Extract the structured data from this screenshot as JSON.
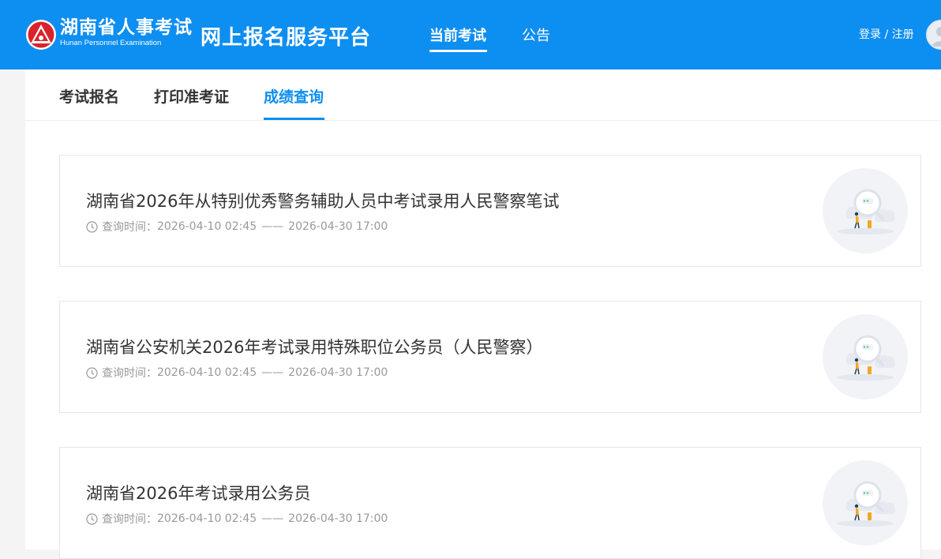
{
  "header": {
    "logo_cn": "湖南省人事考试",
    "logo_en": "Hunan Personnel Examination",
    "platform_title": "网上报名服务平台",
    "nav": [
      {
        "label": "当前考试",
        "active": true
      },
      {
        "label": "公告",
        "active": false
      }
    ],
    "auth_label": "登录 / 注册"
  },
  "subtabs": [
    {
      "label": "考试报名",
      "active": false
    },
    {
      "label": "打印准考证",
      "active": false
    },
    {
      "label": "成绩查询",
      "active": true
    }
  ],
  "exams": [
    {
      "title": "湖南省2026年从特别优秀警务辅助人员中考试录用人民警察笔试",
      "time_label": "查询时间：",
      "start": "2026-04-10 02:45",
      "separator": "——",
      "end": "2026-04-30 17:00"
    },
    {
      "title": "湖南省公安机关2026年考试录用特殊职位公务员（人民警察）",
      "time_label": "查询时间：",
      "start": "2026-04-10 02:45",
      "separator": "——",
      "end": "2026-04-30 17:00"
    },
    {
      "title": "湖南省2026年考试录用公务员",
      "time_label": "查询时间：",
      "start": "2026-04-10 02:45",
      "separator": "——",
      "end": "2026-04-30 17:00"
    }
  ],
  "icons": {
    "logo": "hunan-exam-logo-icon",
    "avatar": "user-avatar-icon",
    "clock": "clock-icon",
    "card_illustration": "search-magnifier-illustration-icon"
  },
  "colors": {
    "brand_blue": "#0d8ef1",
    "logo_red": "#d9232a",
    "accent_orange": "#f5a623"
  }
}
